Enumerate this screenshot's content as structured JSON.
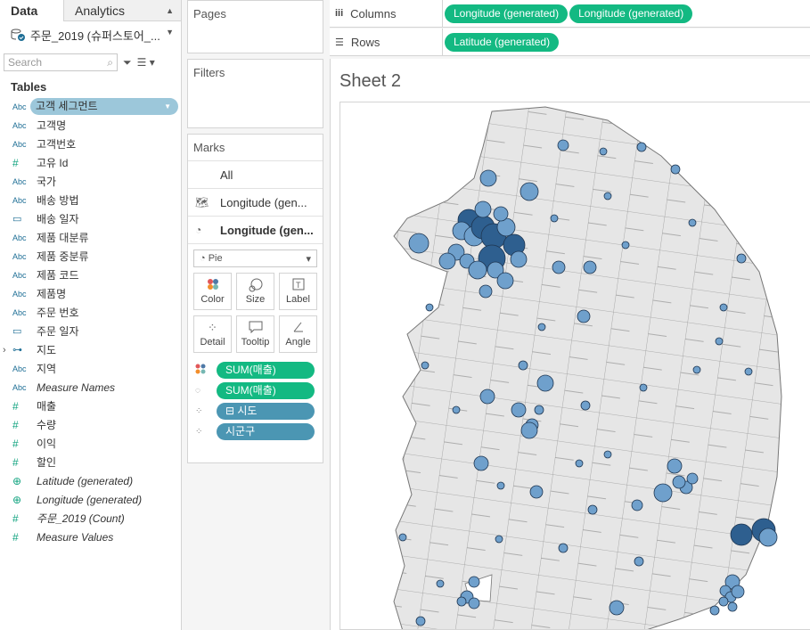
{
  "data_pane": {
    "tabs": {
      "data": "Data",
      "analytics": "Analytics"
    },
    "datasource": "주문_2019 (슈퍼스토어_...",
    "search_placeholder": "Search",
    "tables_header": "Tables",
    "fields": [
      {
        "type": "Abc",
        "name": "고객 세그먼트",
        "selected": true
      },
      {
        "type": "Abc",
        "name": "고객명"
      },
      {
        "type": "Abc",
        "name": "고객번호"
      },
      {
        "type": "#",
        "name": "고유 Id"
      },
      {
        "type": "Abc",
        "name": "국가"
      },
      {
        "type": "Abc",
        "name": "배송 방법"
      },
      {
        "type": "cal",
        "name": "배송 일자"
      },
      {
        "type": "Abc",
        "name": "제품 대분류"
      },
      {
        "type": "Abc",
        "name": "제품 중분류"
      },
      {
        "type": "Abc",
        "name": "제품 코드"
      },
      {
        "type": "Abc",
        "name": "제품명"
      },
      {
        "type": "Abc",
        "name": "주문 번호"
      },
      {
        "type": "cal",
        "name": "주문 일자"
      },
      {
        "type": "hier",
        "name": "지도"
      },
      {
        "type": "Abc",
        "name": "지역"
      },
      {
        "type": "Abc",
        "name": "Measure Names",
        "italic": true
      },
      {
        "type": "#",
        "name": "매출"
      },
      {
        "type": "#",
        "name": "수량"
      },
      {
        "type": "#",
        "name": "이익"
      },
      {
        "type": "#",
        "name": "할인"
      },
      {
        "type": "geo",
        "name": "Latitude (generated)",
        "italic": true
      },
      {
        "type": "geo",
        "name": "Longitude (generated)",
        "italic": true
      },
      {
        "type": "#",
        "name": "주문_2019 (Count)",
        "italic": true
      },
      {
        "type": "#",
        "name": "Measure Values",
        "italic": true
      }
    ]
  },
  "cards": {
    "pages": "Pages",
    "filters": "Filters",
    "marks": "Marks",
    "marks_all": "All",
    "marks_layer1": "Longitude (gen...",
    "marks_layer2": "Longitude (gen...",
    "mark_type": "Pie",
    "buttons": [
      "Color",
      "Size",
      "Label",
      "Detail",
      "Tooltip",
      "Angle"
    ],
    "encodings": [
      {
        "icon": "color",
        "label": "SUM(매출)",
        "color": "#13b982"
      },
      {
        "icon": "size",
        "label": "SUM(매출)",
        "color": "#13b982"
      },
      {
        "icon": "detail",
        "label": "⊟ 시도",
        "color": "#4b96b3"
      },
      {
        "icon": "detail",
        "label": "시군구",
        "color": "#4b96b3"
      }
    ]
  },
  "shelves": {
    "columns_label": "Columns",
    "rows_label": "Rows",
    "columns": [
      "Longitude (generated)",
      "Longitude (generated)"
    ],
    "rows": [
      "Latitude (generated)"
    ]
  },
  "view": {
    "sheet_title": "Sheet 2"
  }
}
